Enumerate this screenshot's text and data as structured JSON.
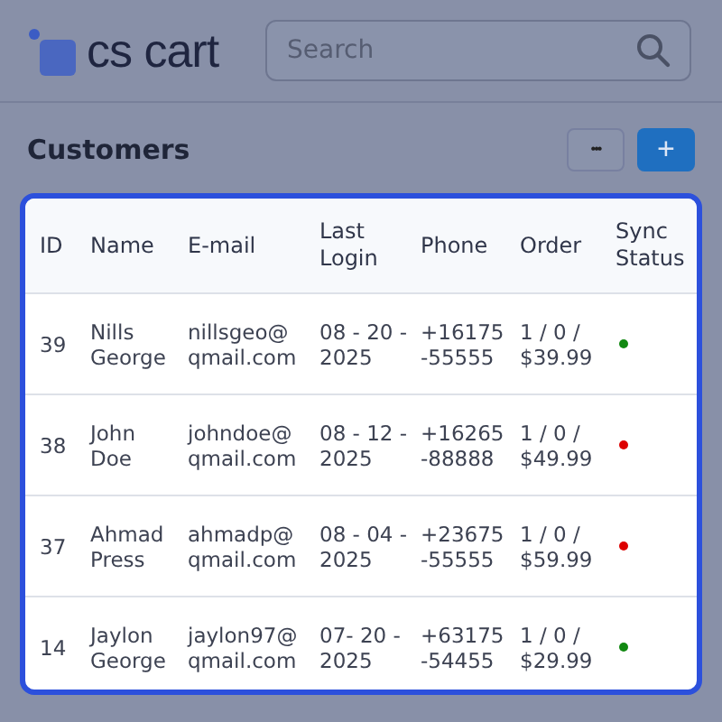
{
  "header": {
    "logo_text": "cs cart",
    "search": {
      "placeholder": "Search"
    }
  },
  "page": {
    "title": "Customers",
    "more_button": "•••",
    "add_button": "+"
  },
  "table": {
    "columns": [
      [
        "ID"
      ],
      [
        "Name"
      ],
      [
        "E-mail"
      ],
      [
        "Last",
        "Login"
      ],
      [
        "Phone"
      ],
      [
        "Order"
      ],
      [
        "Sync",
        "Status"
      ]
    ],
    "rows": [
      {
        "id": "39",
        "name": [
          "Nills",
          "George"
        ],
        "email": [
          "nillsgeo@",
          "qmail.com"
        ],
        "last_login": [
          "08 - 20 -",
          "2025"
        ],
        "phone": [
          "+16175",
          "-55555"
        ],
        "order": [
          "1 / 0 /",
          "$39.99"
        ],
        "sync_status": {
          "color": "#118811"
        }
      },
      {
        "id": "38",
        "name": [
          "John",
          "Doe"
        ],
        "email": [
          "johndoe@",
          "qmail.com"
        ],
        "last_login": [
          "08 - 12 -",
          "2025"
        ],
        "phone": [
          "+16265",
          "-88888"
        ],
        "order": [
          "1 / 0 /",
          "$49.99"
        ],
        "sync_status": {
          "color": "#dd0000"
        }
      },
      {
        "id": "37",
        "name": [
          "Ahmad",
          "Press"
        ],
        "email": [
          "ahmadp@",
          "qmail.com"
        ],
        "last_login": [
          "08 - 04 -",
          "2025"
        ],
        "phone": [
          "+23675",
          "-55555"
        ],
        "order": [
          "1 / 0 /",
          "$59.99"
        ],
        "sync_status": {
          "color": "#dd0000"
        }
      },
      {
        "id": "14",
        "name": [
          "Jaylon",
          "George"
        ],
        "email": [
          "jaylon97@",
          "qmail.com"
        ],
        "last_login": [
          "07- 20 -",
          "2025"
        ],
        "phone": [
          "+63175",
          "-54455"
        ],
        "order": [
          "1 / 0 /",
          "$29.99"
        ],
        "sync_status": {
          "color": "#118811"
        }
      }
    ]
  }
}
